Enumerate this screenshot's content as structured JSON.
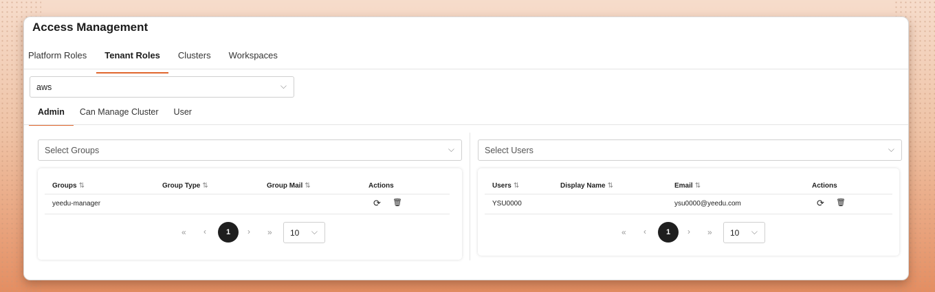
{
  "app": {
    "title": "Access Management"
  },
  "main_tabs": [
    {
      "label": "Platform Roles"
    },
    {
      "label": "Tenant Roles",
      "active": true
    },
    {
      "label": "Clusters"
    },
    {
      "label": "Workspaces"
    }
  ],
  "tenant_select": {
    "value": "aws"
  },
  "role_tabs": [
    {
      "label": "Admin",
      "active": true
    },
    {
      "label": "Can Manage Cluster"
    },
    {
      "label": "User"
    }
  ],
  "groups_panel": {
    "placeholder": "Select Groups",
    "columns": [
      "Groups",
      "Group Type",
      "Group Mail",
      "Actions"
    ],
    "rows": [
      {
        "group": "yeedu-manager",
        "type": "",
        "mail": ""
      }
    ],
    "pagination": {
      "first": "«",
      "prev": "‹",
      "current": "1",
      "next": "›",
      "last": "»",
      "page_size": "10"
    }
  },
  "users_panel": {
    "placeholder": "Select Users",
    "columns": [
      "Users",
      "Display Name",
      "Email",
      "Actions"
    ],
    "rows": [
      {
        "user": "YSU0000",
        "display": "",
        "email": "ysu0000@yeedu.com"
      }
    ],
    "pagination": {
      "first": "«",
      "prev": "‹",
      "current": "1",
      "next": "›",
      "last": "»",
      "page_size": "10"
    }
  },
  "icons": {
    "sort": "⇅",
    "chevron": "⌵",
    "refresh": "⟳",
    "delete": "🗑"
  },
  "colors": {
    "accent": "#e0652c",
    "active_page": "#1f1f1f"
  }
}
